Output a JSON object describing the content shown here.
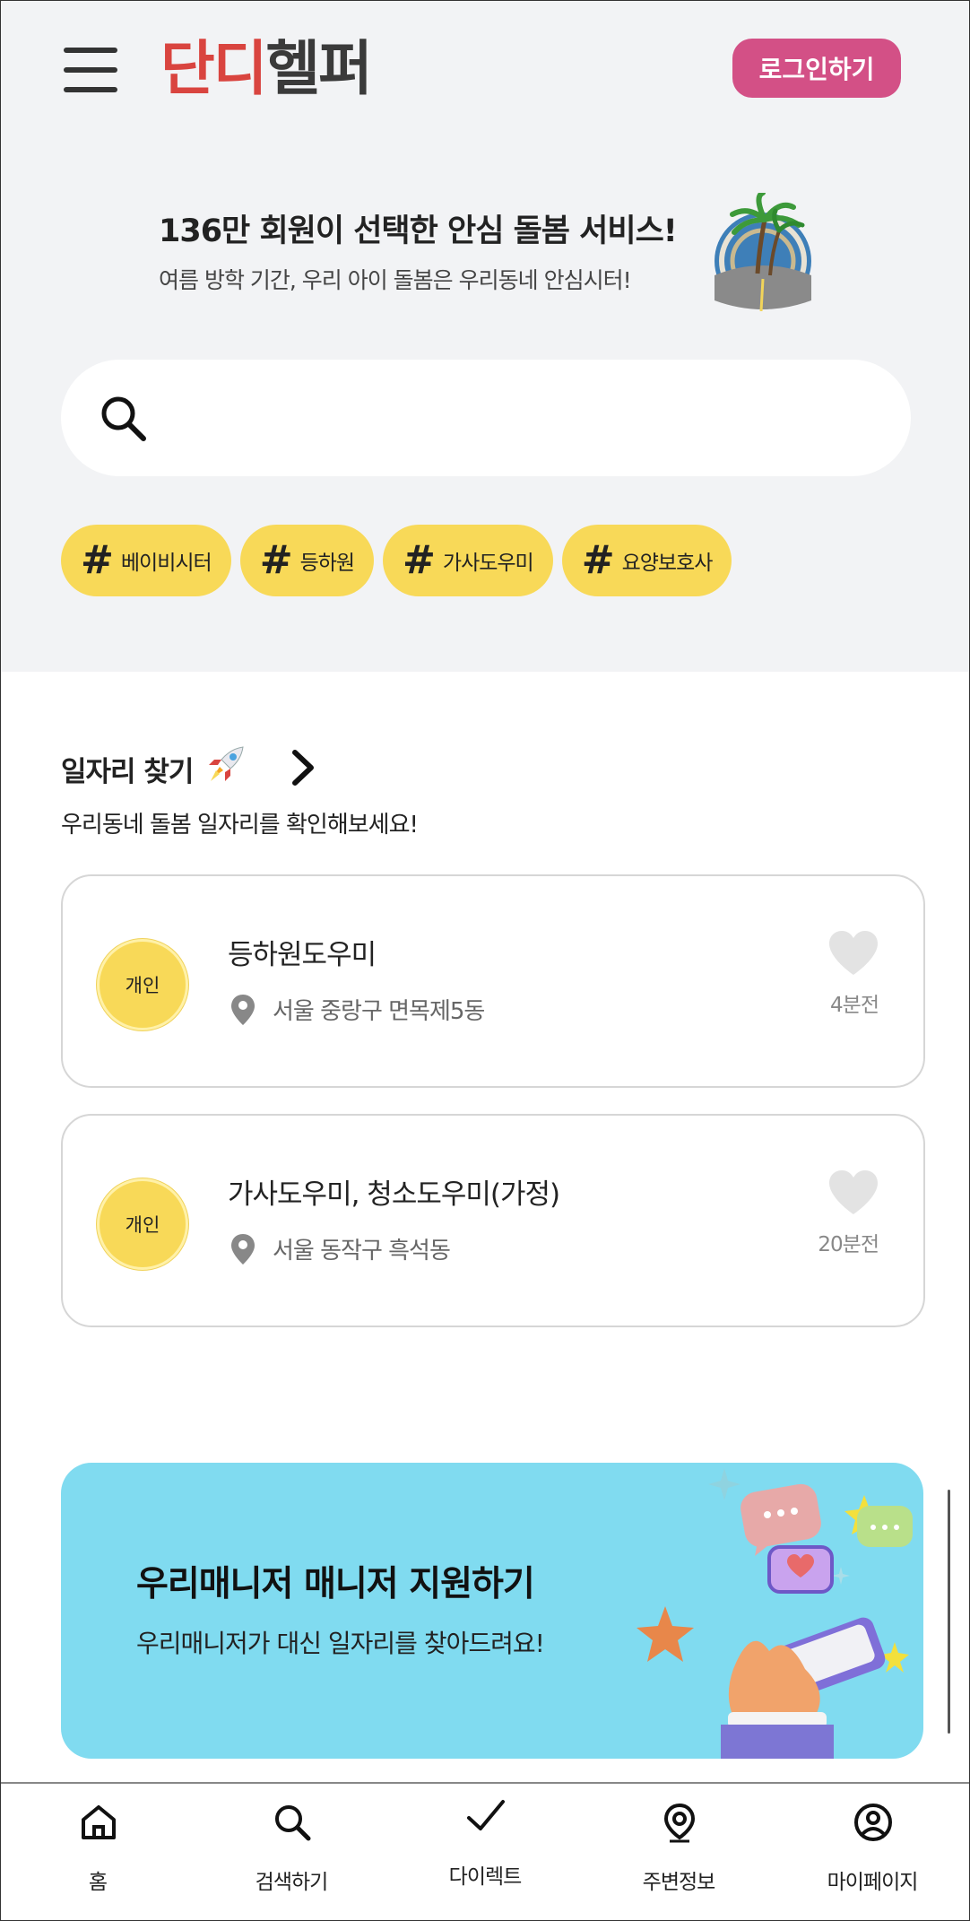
{
  "header": {
    "menu_icon": "hamburger-menu-icon",
    "logo_part1": "단디",
    "logo_part2": "헬퍼",
    "login_label": "로그인하기",
    "brand_red": "#d9443f",
    "login_color": "#d35086"
  },
  "promo": {
    "title": "136만 회원이 선택한 안심 돌봄 서비스!",
    "subtitle": "여름 방학 기간, 우리 아이 돌봄은 우리동네 안심시터!"
  },
  "search": {
    "icon": "search-icon",
    "placeholder": ""
  },
  "tags": [
    {
      "label": "베이비시터"
    },
    {
      "label": "등하원"
    },
    {
      "label": "가사도우미"
    },
    {
      "label": "요양보호사"
    }
  ],
  "tag_color": "#f8d958",
  "jobs_section": {
    "title": "일자리 찾기",
    "subtitle": "우리동네 돌봄 일자리를 확인해보세요!"
  },
  "jobs": [
    {
      "badge": "개인",
      "title": "등하원도우미",
      "location": "서울 중랑구 면목제5동",
      "time": "4분전"
    },
    {
      "badge": "개인",
      "title": "가사도우미, 청소도우미(가정)",
      "location": "서울 동작구 흑석동",
      "time": "20분전"
    }
  ],
  "banner": {
    "title": "우리매니저 매니저 지원하기",
    "subtitle": "우리매니저가 대신 일자리를 찾아드려요!",
    "color": "#80dbf0"
  },
  "nav": [
    {
      "label": "홈",
      "icon": "home-icon"
    },
    {
      "label": "검색하기",
      "icon": "search-icon"
    },
    {
      "label": "다이렉트",
      "icon": "check-icon"
    },
    {
      "label": "주변정보",
      "icon": "location-pin-icon"
    },
    {
      "label": "마이페이지",
      "icon": "user-circle-icon"
    }
  ]
}
